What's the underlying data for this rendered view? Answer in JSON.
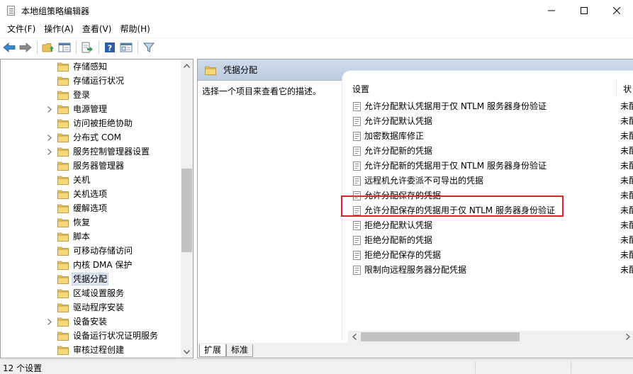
{
  "window": {
    "title": "本地组策略编辑器"
  },
  "menu": [
    "文件(F)",
    "操作(A)",
    "查看(V)",
    "帮助(H)"
  ],
  "toolbar_icons": [
    "back-arrow-icon",
    "forward-arrow-icon",
    "up-folder-icon",
    "show-hide-tree-icon",
    "export-list-icon",
    "help-icon",
    "properties-icon",
    "filter-icon"
  ],
  "tree": {
    "items": [
      {
        "label": "存储感知",
        "expandable": false
      },
      {
        "label": "存储运行状况",
        "expandable": false
      },
      {
        "label": "登录",
        "expandable": false
      },
      {
        "label": "电源管理",
        "expandable": true
      },
      {
        "label": "访问被拒绝协助",
        "expandable": false
      },
      {
        "label": "分布式 COM",
        "expandable": true
      },
      {
        "label": "服务控制管理器设置",
        "expandable": true
      },
      {
        "label": "服务器管理器",
        "expandable": false
      },
      {
        "label": "关机",
        "expandable": false
      },
      {
        "label": "关机选项",
        "expandable": false
      },
      {
        "label": "缓解选项",
        "expandable": false
      },
      {
        "label": "恢复",
        "expandable": false
      },
      {
        "label": "脚本",
        "expandable": false
      },
      {
        "label": "可移动存储访问",
        "expandable": false
      },
      {
        "label": "内核 DMA 保护",
        "expandable": false
      },
      {
        "label": "凭据分配",
        "expandable": false,
        "selected": true
      },
      {
        "label": "区域设置服务",
        "expandable": false
      },
      {
        "label": "驱动程序安装",
        "expandable": false
      },
      {
        "label": "设备安装",
        "expandable": true
      },
      {
        "label": "设备运行状况证明服务",
        "expandable": false
      },
      {
        "label": "审核过程创建",
        "expandable": false
      }
    ]
  },
  "right_pane": {
    "header_title": "凭据分配",
    "description": "选择一个项目来查看它的描述。",
    "columns": {
      "setting": "设置",
      "state": "状"
    },
    "policies": [
      {
        "name": "允许分配默认凭据用于仅 NTLM 服务器身份验证",
        "state": "未配"
      },
      {
        "name": "允许分配默认凭据",
        "state": "未配"
      },
      {
        "name": "加密数据库修正",
        "state": "未配"
      },
      {
        "name": "允许分配新的凭据",
        "state": "未配"
      },
      {
        "name": "允许分配新的凭据用于仅 NTLM 服务器身份验证",
        "state": "未配"
      },
      {
        "name": "远程机允许委派不可导出的凭据",
        "state": "未配"
      },
      {
        "name": "允许分配保存的凭据",
        "state": "未配"
      },
      {
        "name": "允许分配保存的凭据用于仅 NTLM 服务器身份验证",
        "state": "未配",
        "highlighted": true
      },
      {
        "name": "拒绝分配默认凭据",
        "state": "未配"
      },
      {
        "name": "拒绝分配新的凭据",
        "state": "未配"
      },
      {
        "name": "拒绝分配保存的凭据",
        "state": "未配"
      },
      {
        "name": "限制向远程服务器分配凭据",
        "state": "未配"
      }
    ],
    "tabs": [
      "扩展",
      "标准"
    ]
  },
  "status": {
    "text": "12 个设置"
  },
  "colors": {
    "highlight_border": "#d9252a",
    "header_bg": "#c6d4e6",
    "folder": "#e8c15a"
  }
}
